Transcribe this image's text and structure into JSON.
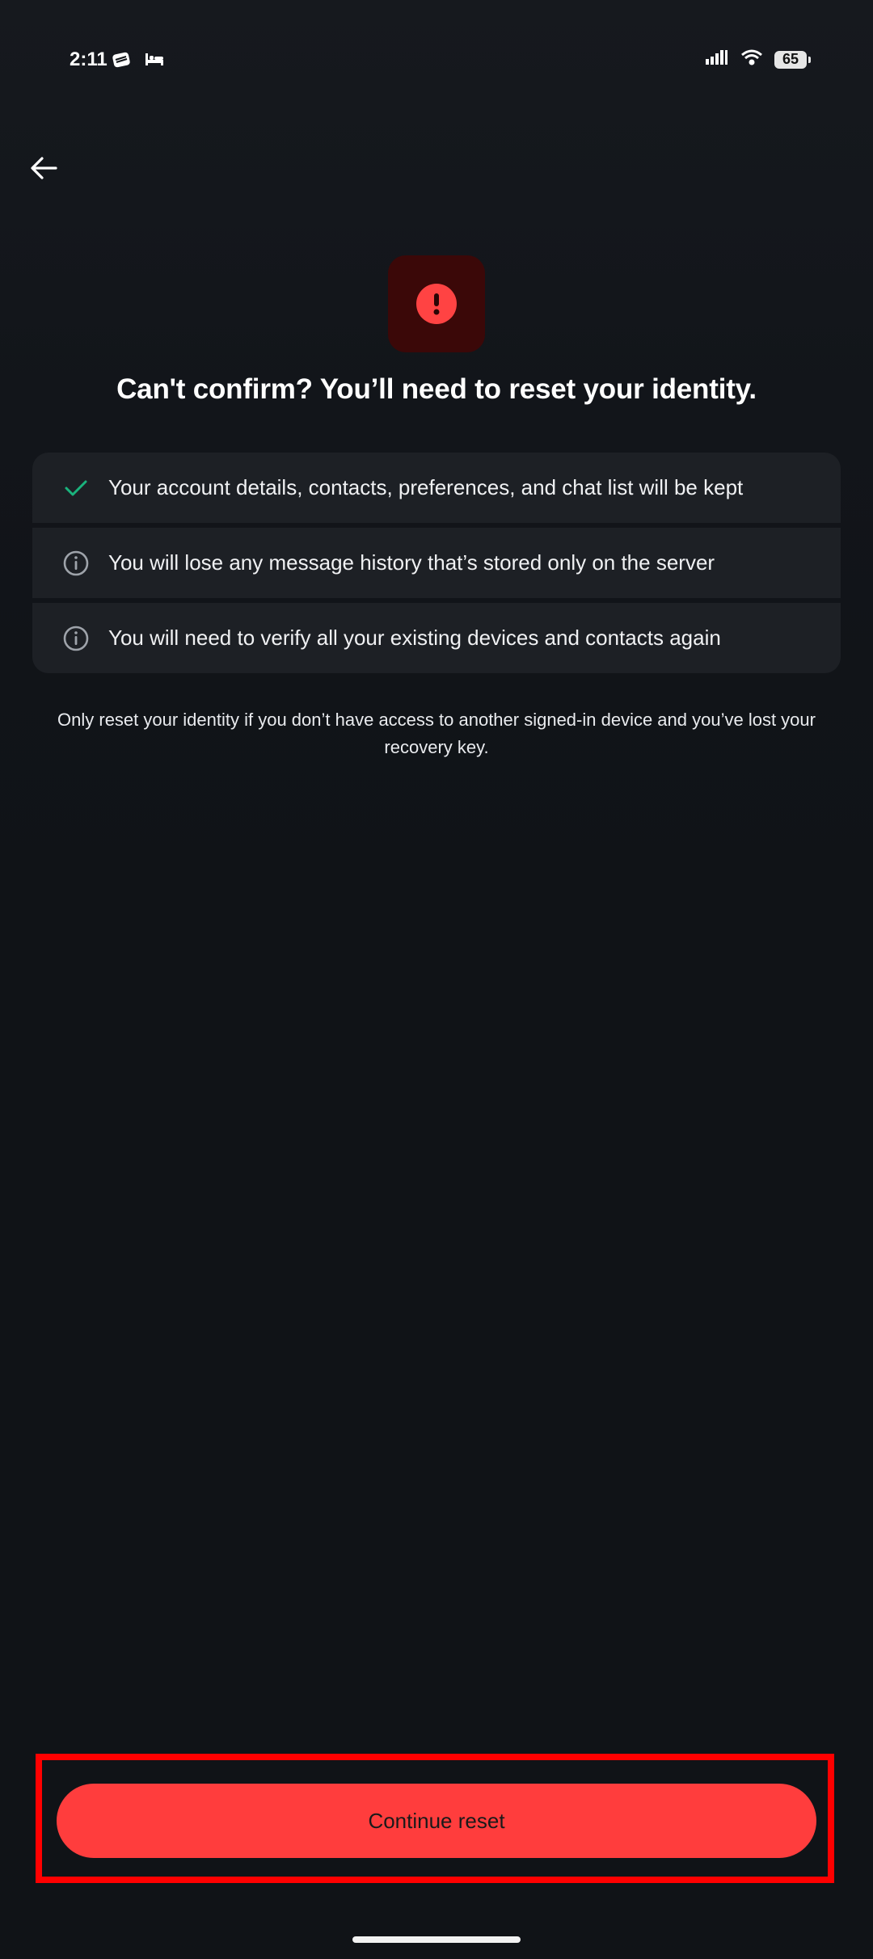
{
  "status_bar": {
    "time": "2:11",
    "battery": "65",
    "left_icons": [
      "notification-app-icon",
      "bed-icon"
    ],
    "right_icons": [
      "signal-icon",
      "wifi-icon",
      "battery-icon"
    ]
  },
  "header": {
    "back_icon": "arrow-left-icon"
  },
  "alert": {
    "icon": "exclamation-icon",
    "tile_color": "#3b0808",
    "icon_color": "#ff4343"
  },
  "title": "Can't confirm? You’ll need to reset your identity.",
  "info_items": [
    {
      "icon": "check-icon",
      "text": "Your account details, contacts, preferences, and chat list will be kept"
    },
    {
      "icon": "info-icon",
      "text": "You will lose any message history that’s stored only on the server"
    },
    {
      "icon": "info-icon",
      "text": "You will need to verify all your existing devices and contacts again"
    }
  ],
  "note": "Only reset your identity if you don’t have access to another signed-in device and you’ve lost your recovery key.",
  "actions": {
    "continue_label": "Continue reset"
  },
  "colors": {
    "background": "#101317",
    "danger": "#ff3d3d",
    "success": "#1ab37d",
    "highlight": "#ff0000"
  }
}
